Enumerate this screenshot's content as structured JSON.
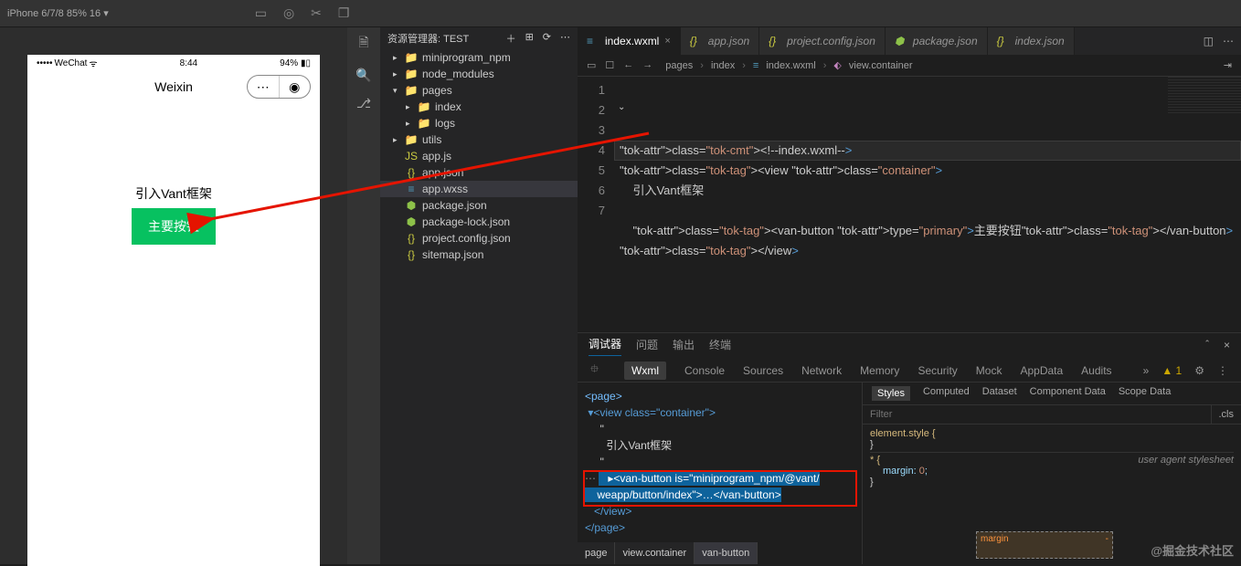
{
  "topbar": {
    "device": "iPhone 6/7/8 85% 16 ▾"
  },
  "phone": {
    "carrier": "WeChat",
    "time": "8:44",
    "battery": "94%",
    "title": "Weixin",
    "body_text": "引入Vant框架",
    "button": "主要按钮"
  },
  "explorer": {
    "title": "资源管理器: TEST",
    "items": [
      {
        "depth": 1,
        "chev": "▸",
        "ico": "📁",
        "cls": "f-folder",
        "label": "miniprogram_npm"
      },
      {
        "depth": 1,
        "chev": "▸",
        "ico": "📁",
        "cls": "f-folder",
        "label": "node_modules"
      },
      {
        "depth": 1,
        "chev": "▾",
        "ico": "📁",
        "cls": "f-orange",
        "label": "pages"
      },
      {
        "depth": 2,
        "chev": "▸",
        "ico": "📁",
        "cls": "f-folder",
        "label": "index"
      },
      {
        "depth": 2,
        "chev": "▸",
        "ico": "📁",
        "cls": "f-folder",
        "label": "logs"
      },
      {
        "depth": 1,
        "chev": "▸",
        "ico": "📁",
        "cls": "f-folder",
        "label": "utils"
      },
      {
        "depth": 1,
        "chev": "",
        "ico": "JS",
        "cls": "f-yellow",
        "label": "app.js"
      },
      {
        "depth": 1,
        "chev": "",
        "ico": "{}",
        "cls": "f-yellow",
        "label": "app.json"
      },
      {
        "depth": 1,
        "chev": "",
        "ico": "≡",
        "cls": "f-blue",
        "label": "app.wxss",
        "sel": true
      },
      {
        "depth": 1,
        "chev": "",
        "ico": "⬢",
        "cls": "f-green",
        "label": "package.json"
      },
      {
        "depth": 1,
        "chev": "",
        "ico": "⬢",
        "cls": "f-green",
        "label": "package-lock.json"
      },
      {
        "depth": 1,
        "chev": "",
        "ico": "{}",
        "cls": "f-yellow",
        "label": "project.config.json"
      },
      {
        "depth": 1,
        "chev": "",
        "ico": "{}",
        "cls": "f-yellow",
        "label": "sitemap.json"
      }
    ]
  },
  "tabs": [
    {
      "ico": "≡",
      "cls": "f-blue",
      "label": "index.wxml",
      "active": true,
      "close": "×"
    },
    {
      "ico": "{}",
      "cls": "f-yellow",
      "label": "app.json"
    },
    {
      "ico": "{}",
      "cls": "f-yellow",
      "label": "project.config.json"
    },
    {
      "ico": "⬢",
      "cls": "f-green",
      "label": "package.json",
      "italic": true
    },
    {
      "ico": "{}",
      "cls": "f-yellow",
      "label": "index.json"
    }
  ],
  "breadcrumb": [
    "pages",
    "index",
    "index.wxml",
    "view.container"
  ],
  "code": {
    "lines": [
      "<!--index.wxml-->",
      "<view class=\"container\">",
      "    引入Vant框架",
      "",
      "    <van-button type=\"primary\">主要按钮</van-button>",
      "</view>",
      ""
    ]
  },
  "panel_tabs": [
    "调试器",
    "问题",
    "输出",
    "终端"
  ],
  "debug_tabs": [
    "Wxml",
    "Console",
    "Sources",
    "Network",
    "Memory",
    "Security",
    "Mock",
    "AppData",
    "Audits"
  ],
  "warn_count": "1",
  "elements": {
    "l1": "<page>",
    "l2": " ▾<view class=\"container\">",
    "l3": "     \"",
    "l4": "       引入Vant框架",
    "l5": "     \"",
    "l6a": "   ▸<van-button is=\"miniprogram_npm/@vant/",
    "l6b": "    weapp/button/index\">…</van-button>",
    "l7": "   </view>",
    "l8": "</page>"
  },
  "crumb_path": [
    "page",
    "view.container",
    "van-button"
  ],
  "styles": {
    "tabs": [
      "Styles",
      "Computed",
      "Dataset",
      "Component Data",
      "Scope Data"
    ],
    "filter_ph": "Filter",
    "cls": ".cls",
    "elstyle": "element.style {",
    "close1": "}",
    "star": "* {",
    "uas": "user agent stylesheet",
    "margin_prop": "margin",
    "margin_val": "0",
    "close2": "}",
    "box_label": "margin",
    "box_dash": "-"
  },
  "watermark": "@掘金技术社区"
}
